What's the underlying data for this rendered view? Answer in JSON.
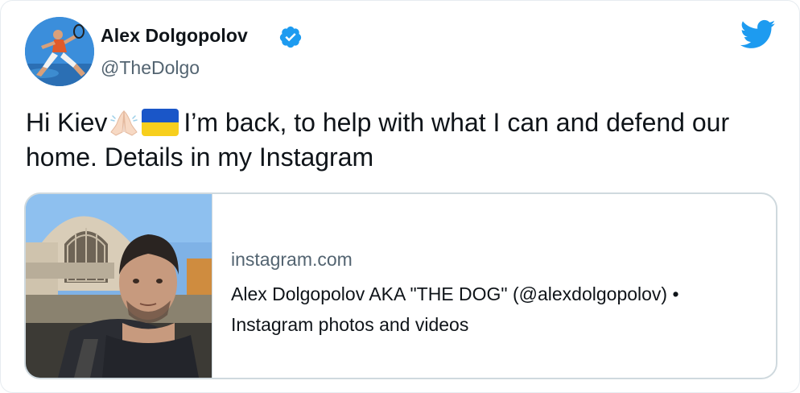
{
  "author": {
    "name": "Alex Dolgopolov",
    "handle": "@TheDolgo",
    "verified": true
  },
  "tweet": {
    "text_part1": "Hi Kiev",
    "text_part2": "I’m back, to help with what I can and defend our home. Details in my Instagram",
    "emojis": [
      "folded-hands-emoji",
      "ukraine-flag-emoji"
    ]
  },
  "link_card": {
    "domain": "instagram.com",
    "title": "Alex Dolgopolov AKA \"THE DOG\" (@alexdolgopolov) • Instagram photos and videos"
  },
  "icons": {
    "brand": "twitter-bird-icon",
    "verified": "verified-badge-icon"
  },
  "colors": {
    "twitter_blue": "#1d9bf0",
    "text_primary": "#0f1419",
    "text_secondary": "#536471",
    "border": "#cfd9de"
  }
}
